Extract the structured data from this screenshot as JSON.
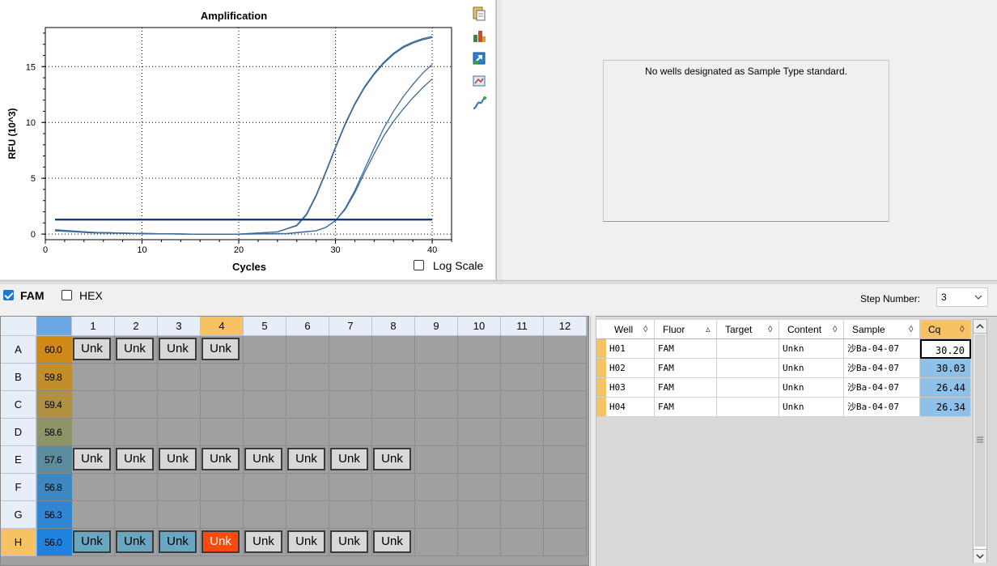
{
  "chart": {
    "title": "Amplification",
    "xlabel": "Cycles",
    "ylabel": "RFU (10^3)",
    "log_scale_label": "Log Scale",
    "log_scale_checked": false
  },
  "chart_data": {
    "type": "line",
    "title": "Amplification",
    "xlabel": "Cycles",
    "ylabel": "RFU (10^3)",
    "xlim": [
      0,
      42
    ],
    "ylim": [
      -0.5,
      18.5
    ],
    "xticks": [
      0,
      10,
      20,
      30,
      40
    ],
    "yticks": [
      0,
      5,
      10,
      15
    ],
    "grid": true,
    "threshold": 1.3,
    "series": [
      {
        "x": [
          1,
          5,
          10,
          15,
          20,
          24,
          26,
          27,
          28,
          29,
          30,
          31,
          32,
          33,
          34,
          35,
          36,
          37,
          38,
          39,
          40
        ],
        "y": [
          0.3,
          0.15,
          0.05,
          0,
          0,
          0.2,
          0.8,
          1.8,
          3.5,
          5.6,
          7.8,
          9.9,
          11.7,
          13.2,
          14.4,
          15.4,
          16.2,
          16.8,
          17.2,
          17.5,
          17.7
        ]
      },
      {
        "x": [
          1,
          5,
          10,
          15,
          20,
          24,
          26,
          27,
          28,
          29,
          30,
          31,
          32,
          33,
          34,
          35,
          36,
          37,
          38,
          39,
          40
        ],
        "y": [
          0.3,
          0.15,
          0.05,
          0,
          0,
          0.2,
          0.75,
          1.7,
          3.4,
          5.5,
          7.7,
          9.8,
          11.6,
          13.1,
          14.3,
          15.3,
          16.1,
          16.7,
          17.1,
          17.4,
          17.6
        ]
      },
      {
        "x": [
          1,
          5,
          10,
          15,
          20,
          25,
          28,
          29,
          30,
          31,
          32,
          33,
          34,
          35,
          36,
          37,
          38,
          39,
          40
        ],
        "y": [
          0.4,
          0.15,
          0.05,
          0,
          0,
          0.05,
          0.3,
          0.6,
          1.2,
          2.3,
          3.9,
          5.8,
          7.7,
          9.5,
          11.0,
          12.3,
          13.4,
          14.4,
          15.2
        ]
      },
      {
        "x": [
          1,
          5,
          10,
          15,
          20,
          25,
          28,
          29,
          30,
          31,
          32,
          33,
          34,
          35,
          36,
          37,
          38,
          39,
          40
        ],
        "y": [
          0.3,
          0.1,
          0.05,
          0,
          0,
          0.05,
          0.3,
          0.6,
          1.2,
          2.2,
          3.7,
          5.5,
          7.2,
          8.8,
          10.1,
          11.2,
          12.2,
          13.1,
          13.9
        ]
      }
    ]
  },
  "standard_curve": {
    "message": "No wells designated as Sample Type standard."
  },
  "fluors": [
    {
      "label": "FAM",
      "checked": true
    },
    {
      "label": "HEX",
      "checked": false
    }
  ],
  "step": {
    "label": "Step Number:",
    "value": "3"
  },
  "plate": {
    "columns": [
      "1",
      "2",
      "3",
      "4",
      "5",
      "6",
      "7",
      "8",
      "9",
      "10",
      "11",
      "12"
    ],
    "selected_column": "4",
    "selected_row": "H",
    "rows": [
      {
        "label": "A",
        "temp": "60.0",
        "temp_color": "#cf8a17",
        "wells": [
          "Unk",
          "Unk",
          "Unk",
          "Unk",
          "",
          "",
          "",
          "",
          "",
          "",
          "",
          ""
        ]
      },
      {
        "label": "B",
        "temp": "59.8",
        "temp_color": "#c18e2a",
        "wells": [
          "",
          "",
          "",
          "",
          "",
          "",
          "",
          "",
          "",
          "",
          "",
          ""
        ]
      },
      {
        "label": "C",
        "temp": "59.4",
        "temp_color": "#b09141",
        "wells": [
          "",
          "",
          "",
          "",
          "",
          "",
          "",
          "",
          "",
          "",
          "",
          ""
        ]
      },
      {
        "label": "D",
        "temp": "58.6",
        "temp_color": "#8c9468",
        "wells": [
          "",
          "",
          "",
          "",
          "",
          "",
          "",
          "",
          "",
          "",
          "",
          ""
        ]
      },
      {
        "label": "E",
        "temp": "57.6",
        "temp_color": "#5b8d9e",
        "wells": [
          "Unk",
          "Unk",
          "Unk",
          "Unk",
          "Unk",
          "Unk",
          "Unk",
          "Unk",
          "",
          "",
          "",
          ""
        ]
      },
      {
        "label": "F",
        "temp": "56.8",
        "temp_color": "#3d88c2",
        "wells": [
          "",
          "",
          "",
          "",
          "",
          "",
          "",
          "",
          "",
          "",
          "",
          ""
        ]
      },
      {
        "label": "G",
        "temp": "56.3",
        "temp_color": "#2f86d3",
        "wells": [
          "",
          "",
          "",
          "",
          "",
          "",
          "",
          "",
          "",
          "",
          "",
          ""
        ]
      },
      {
        "label": "H",
        "temp": "56.0",
        "temp_color": "#1f82df",
        "wells": [
          "Unk",
          "Unk",
          "Unk",
          "Unk",
          "Unk",
          "Unk",
          "Unk",
          "Unk",
          "",
          "",
          "",
          ""
        ]
      }
    ]
  },
  "results": {
    "columns": [
      "Well",
      "Fluor",
      "Target",
      "Content",
      "Sample",
      "Cq"
    ],
    "rows": [
      {
        "well": "H01",
        "fluor": "FAM",
        "target": "",
        "content": "Unkn",
        "sample": "沙Ba-04-07",
        "cq": "30.20"
      },
      {
        "well": "H02",
        "fluor": "FAM",
        "target": "",
        "content": "Unkn",
        "sample": "沙Ba-04-07",
        "cq": "30.03"
      },
      {
        "well": "H03",
        "fluor": "FAM",
        "target": "",
        "content": "Unkn",
        "sample": "沙Ba-04-07",
        "cq": "26.44"
      },
      {
        "well": "H04",
        "fluor": "FAM",
        "target": "",
        "content": "Unkn",
        "sample": "沙Ba-04-07",
        "cq": "26.34"
      }
    ]
  }
}
